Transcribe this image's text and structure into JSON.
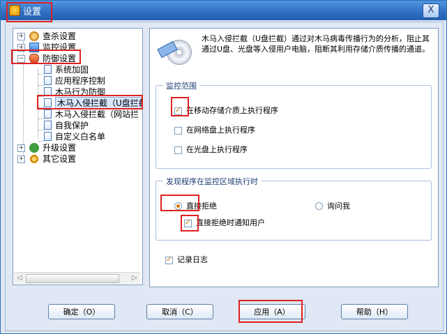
{
  "window": {
    "title": "设置",
    "close_symbol": "X"
  },
  "tree": {
    "items": [
      {
        "label": "查杀设置"
      },
      {
        "label": "监控设置"
      },
      {
        "label": "防御设置"
      },
      {
        "label": "系统加固"
      },
      {
        "label": "应用程序控制"
      },
      {
        "label": "木马行为防御"
      },
      {
        "label": "木马入侵拦截（U盘拦截"
      },
      {
        "label": "木马入侵拦截（网站拦"
      },
      {
        "label": "自我保护"
      },
      {
        "label": "自定义白名单"
      },
      {
        "label": "升级设置"
      },
      {
        "label": "其它设置"
      }
    ],
    "expanders": {
      "collapsed": "+",
      "expanded": "−"
    },
    "scroll_left": "◁",
    "scroll_right": "▷"
  },
  "panel": {
    "description": "木马入侵拦截（U盘拦截）通过对木马病毒传播行为的分析，阻止其通过U盘、光盘等入侵用户电脑，阻断其利用存储介质传播的通道。",
    "monitor_scope": {
      "title": "监控范围",
      "options": [
        {
          "label": "在移动存储介质上执行程序",
          "checked": true
        },
        {
          "label": "在网络盘上执行程序",
          "checked": false
        },
        {
          "label": "在光盘上执行程序",
          "checked": false
        }
      ]
    },
    "found_program": {
      "title": "发现程序在监控区域执行时",
      "radio_options": [
        {
          "label": "直接拒绝",
          "selected": true
        },
        {
          "label": "询问我",
          "selected": false
        }
      ],
      "notify": {
        "label": "直接拒绝时通知用户",
        "checked": true
      }
    },
    "log": {
      "label": "记录日志",
      "checked": true
    }
  },
  "buttons": {
    "ok": "确定（O）",
    "cancel": "取消（C）",
    "apply": "应用（A）",
    "help": "帮助（H）"
  },
  "icons": {
    "title": "shield-badge-icon",
    "scan": "scan-settings-icon",
    "monitor": "monitor-settings-icon",
    "defense": "shield-icon",
    "upgrade": "check-circle-icon",
    "other": "gear-icon",
    "document": "document-icon",
    "usb_disk": "usb-disk-icon"
  }
}
